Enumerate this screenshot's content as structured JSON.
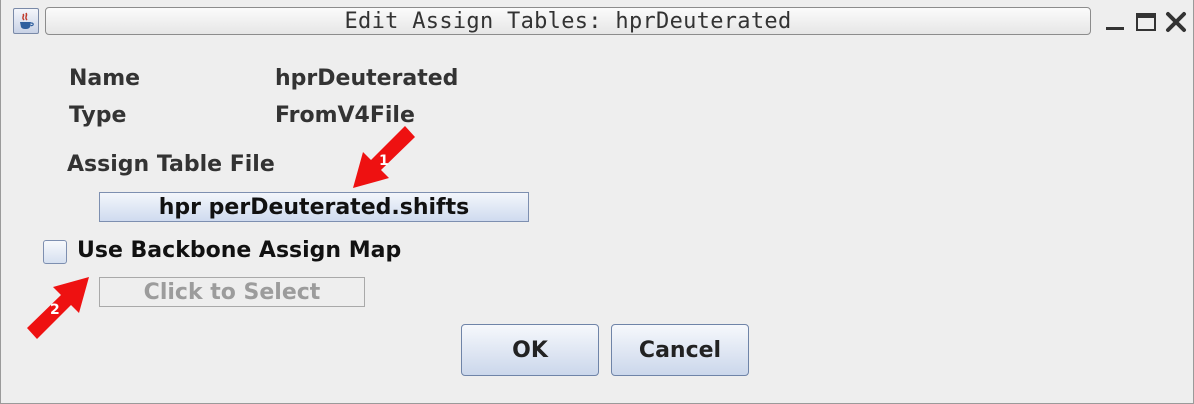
{
  "window": {
    "title": "Edit Assign Tables: hprDeuterated",
    "app_icon": "java-app-icon",
    "controls": [
      "minimize-icon",
      "maximize-icon",
      "close-icon"
    ]
  },
  "fields": {
    "name_label": "Name",
    "name_value": "hprDeuterated",
    "type_label": "Type",
    "type_value": "FromV4File",
    "assign_table_file_label": "Assign Table File"
  },
  "file_button": {
    "label": "hpr perDeuterated.shifts"
  },
  "backbone": {
    "checkbox_label": "Use Backbone Assign Map",
    "checked": false,
    "select_button_label": "Click to Select",
    "select_enabled": false
  },
  "buttons": {
    "ok": "OK",
    "cancel": "Cancel"
  },
  "annotations": {
    "arrow_1_label": "1",
    "arrow_2_label": "2",
    "arrow_color": "#ee1111"
  },
  "colors": {
    "background": "#eeeeee",
    "button_gradient_top": "#f6f8fc",
    "button_gradient_bottom": "#cbd7eb",
    "button_border": "#6f84a8",
    "disabled_text": "#9c9c9c"
  }
}
